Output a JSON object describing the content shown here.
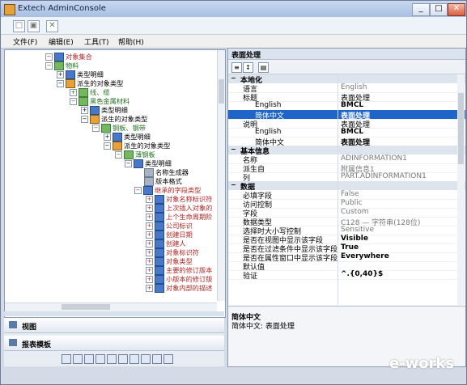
{
  "window": {
    "title": "Extech AdminConsole",
    "buttons": {
      "minimize": "_",
      "maximize": "□",
      "close": "✕"
    }
  },
  "menu": {
    "items": [
      "文件(F)",
      "编辑(E)",
      "工具(T)",
      "帮助(H)"
    ]
  },
  "left_tree": {
    "nodes": [
      {
        "label": "对象集合",
        "kind": "red",
        "expanded": true
      },
      {
        "label": "物料",
        "kind": "green",
        "expanded": true
      },
      {
        "label": "类型明细",
        "kind": "blue",
        "expanded": true
      },
      {
        "label": "派生的对象类型",
        "kind": "green",
        "expanded": true
      },
      {
        "label": "线、缆",
        "kind": "green",
        "expanded": false
      },
      {
        "label": "黑色金属材料",
        "kind": "green",
        "expanded": true
      },
      {
        "label": "类型明细",
        "kind": "blue",
        "expanded": true
      },
      {
        "label": "派生的对象类型",
        "kind": "green",
        "expanded": true
      },
      {
        "label": "钢板、钢带",
        "kind": "green",
        "expanded": true
      },
      {
        "label": "类型明细",
        "kind": "blue",
        "expanded": true
      },
      {
        "label": "派生的对象类型",
        "kind": "green",
        "expanded": true
      },
      {
        "label": "薄钢板",
        "kind": "green",
        "expanded": true
      },
      {
        "label": "类型明细",
        "kind": "blue",
        "expanded": true
      },
      {
        "label": "名称生成器",
        "kind": "gray",
        "expanded": false
      },
      {
        "label": "版本格式",
        "kind": "gray",
        "expanded": false
      },
      {
        "label": "继承的字段类型",
        "kind": "red",
        "expanded": true
      },
      {
        "label": "对象名称标识符",
        "kind": "red",
        "expanded": false
      },
      {
        "label": "上次插入对象的",
        "kind": "red",
        "expanded": false
      },
      {
        "label": "上个生命周期阶",
        "kind": "red",
        "expanded": false
      },
      {
        "label": "公司标识",
        "kind": "red",
        "expanded": false
      },
      {
        "label": "创建日期",
        "kind": "red",
        "expanded": false
      },
      {
        "label": "创建人",
        "kind": "red",
        "expanded": false
      },
      {
        "label": "对象标识符",
        "kind": "red",
        "expanded": false
      },
      {
        "label": "对象类型",
        "kind": "red",
        "expanded": false
      },
      {
        "label": "主要的修订版本",
        "kind": "red",
        "expanded": false
      },
      {
        "label": "小版本的修订版",
        "kind": "red",
        "expanded": false
      },
      {
        "label": "对象内部的描述",
        "kind": "red",
        "expanded": false
      }
    ]
  },
  "bottom_tabs": {
    "view": "视图",
    "report_template": "报表模板"
  },
  "property_panel": {
    "title": "表面处理",
    "sections": [
      {
        "name": "本地化",
        "rows": [
          {
            "key": "语言",
            "value": "English",
            "dim": true
          },
          {
            "key": "标题",
            "value": "表面处理",
            "dim": false,
            "bold": true
          },
          {
            "key": "English",
            "value": "BMCL",
            "dim": false,
            "sub": true,
            "bold": true
          },
          {
            "key": "简体中文",
            "value": "表面处理",
            "dim": false,
            "sub": true,
            "selected": true,
            "bold": true
          },
          {
            "key": "说明",
            "value": "表面处理",
            "dim": false,
            "bold": true
          },
          {
            "key": "English",
            "value": "BMCL",
            "dim": false,
            "sub": true,
            "bold": true
          },
          {
            "key": "简体中文",
            "value": "表面处理",
            "dim": false,
            "sub": true,
            "bold": true
          }
        ]
      },
      {
        "name": "基本信息",
        "rows": [
          {
            "key": "名称",
            "value": "ADINFORMATION1",
            "dim": true
          },
          {
            "key": "派生自",
            "value": "附属信息1",
            "dim": true
          },
          {
            "key": "列",
            "value": "PART.ADINFORMATION1",
            "dim": true
          }
        ]
      },
      {
        "name": "数据",
        "rows": [
          {
            "key": "必填字段",
            "value": "False",
            "dim": true
          },
          {
            "key": "访问控制",
            "value": "Public",
            "dim": true
          },
          {
            "key": "字段",
            "value": "Custom",
            "dim": true
          },
          {
            "key": "数据类型",
            "value": "C128 — 字符串(128位)",
            "dim": true
          },
          {
            "key": "选择时大小写控制",
            "value": "Sensitive",
            "dim": true
          },
          {
            "key": "是否在视图中显示该字段",
            "value": "Visible",
            "dim": false,
            "bold": true
          },
          {
            "key": "是否在过滤条件中显示该字段",
            "value": "True",
            "dim": false,
            "bold": true
          },
          {
            "key": "是否在属性窗口中显示该字段",
            "value": "Everywhere",
            "dim": false,
            "bold": true
          },
          {
            "key": "默认值",
            "value": "",
            "dim": true
          },
          {
            "key": "验证",
            "value": "^.{0,40}$",
            "dim": false,
            "bold": true
          }
        ]
      }
    ],
    "description": {
      "title": "简体中文",
      "text": "简体中文: 表面处理"
    }
  },
  "watermark": "e-works"
}
